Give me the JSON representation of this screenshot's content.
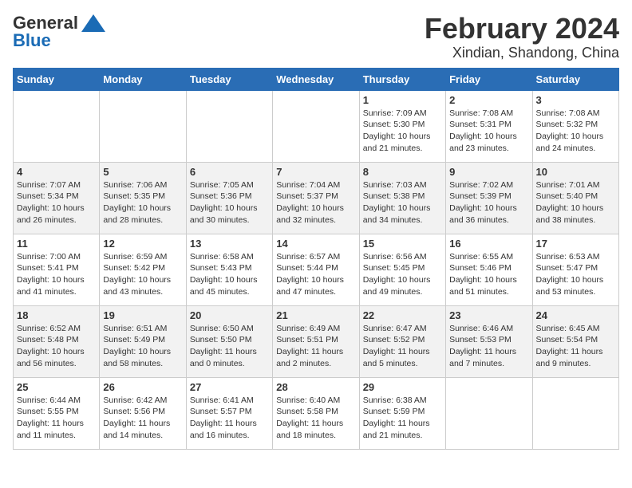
{
  "logo": {
    "general": "General",
    "blue": "Blue"
  },
  "title": "February 2024",
  "subtitle": "Xindian, Shandong, China",
  "days_of_week": [
    "Sunday",
    "Monday",
    "Tuesday",
    "Wednesday",
    "Thursday",
    "Friday",
    "Saturday"
  ],
  "weeks": [
    [
      {
        "day": "",
        "info": ""
      },
      {
        "day": "",
        "info": ""
      },
      {
        "day": "",
        "info": ""
      },
      {
        "day": "",
        "info": ""
      },
      {
        "day": "1",
        "info": "Sunrise: 7:09 AM\nSunset: 5:30 PM\nDaylight: 10 hours and 21 minutes."
      },
      {
        "day": "2",
        "info": "Sunrise: 7:08 AM\nSunset: 5:31 PM\nDaylight: 10 hours and 23 minutes."
      },
      {
        "day": "3",
        "info": "Sunrise: 7:08 AM\nSunset: 5:32 PM\nDaylight: 10 hours and 24 minutes."
      }
    ],
    [
      {
        "day": "4",
        "info": "Sunrise: 7:07 AM\nSunset: 5:34 PM\nDaylight: 10 hours and 26 minutes."
      },
      {
        "day": "5",
        "info": "Sunrise: 7:06 AM\nSunset: 5:35 PM\nDaylight: 10 hours and 28 minutes."
      },
      {
        "day": "6",
        "info": "Sunrise: 7:05 AM\nSunset: 5:36 PM\nDaylight: 10 hours and 30 minutes."
      },
      {
        "day": "7",
        "info": "Sunrise: 7:04 AM\nSunset: 5:37 PM\nDaylight: 10 hours and 32 minutes."
      },
      {
        "day": "8",
        "info": "Sunrise: 7:03 AM\nSunset: 5:38 PM\nDaylight: 10 hours and 34 minutes."
      },
      {
        "day": "9",
        "info": "Sunrise: 7:02 AM\nSunset: 5:39 PM\nDaylight: 10 hours and 36 minutes."
      },
      {
        "day": "10",
        "info": "Sunrise: 7:01 AM\nSunset: 5:40 PM\nDaylight: 10 hours and 38 minutes."
      }
    ],
    [
      {
        "day": "11",
        "info": "Sunrise: 7:00 AM\nSunset: 5:41 PM\nDaylight: 10 hours and 41 minutes."
      },
      {
        "day": "12",
        "info": "Sunrise: 6:59 AM\nSunset: 5:42 PM\nDaylight: 10 hours and 43 minutes."
      },
      {
        "day": "13",
        "info": "Sunrise: 6:58 AM\nSunset: 5:43 PM\nDaylight: 10 hours and 45 minutes."
      },
      {
        "day": "14",
        "info": "Sunrise: 6:57 AM\nSunset: 5:44 PM\nDaylight: 10 hours and 47 minutes."
      },
      {
        "day": "15",
        "info": "Sunrise: 6:56 AM\nSunset: 5:45 PM\nDaylight: 10 hours and 49 minutes."
      },
      {
        "day": "16",
        "info": "Sunrise: 6:55 AM\nSunset: 5:46 PM\nDaylight: 10 hours and 51 minutes."
      },
      {
        "day": "17",
        "info": "Sunrise: 6:53 AM\nSunset: 5:47 PM\nDaylight: 10 hours and 53 minutes."
      }
    ],
    [
      {
        "day": "18",
        "info": "Sunrise: 6:52 AM\nSunset: 5:48 PM\nDaylight: 10 hours and 56 minutes."
      },
      {
        "day": "19",
        "info": "Sunrise: 6:51 AM\nSunset: 5:49 PM\nDaylight: 10 hours and 58 minutes."
      },
      {
        "day": "20",
        "info": "Sunrise: 6:50 AM\nSunset: 5:50 PM\nDaylight: 11 hours and 0 minutes."
      },
      {
        "day": "21",
        "info": "Sunrise: 6:49 AM\nSunset: 5:51 PM\nDaylight: 11 hours and 2 minutes."
      },
      {
        "day": "22",
        "info": "Sunrise: 6:47 AM\nSunset: 5:52 PM\nDaylight: 11 hours and 5 minutes."
      },
      {
        "day": "23",
        "info": "Sunrise: 6:46 AM\nSunset: 5:53 PM\nDaylight: 11 hours and 7 minutes."
      },
      {
        "day": "24",
        "info": "Sunrise: 6:45 AM\nSunset: 5:54 PM\nDaylight: 11 hours and 9 minutes."
      }
    ],
    [
      {
        "day": "25",
        "info": "Sunrise: 6:44 AM\nSunset: 5:55 PM\nDaylight: 11 hours and 11 minutes."
      },
      {
        "day": "26",
        "info": "Sunrise: 6:42 AM\nSunset: 5:56 PM\nDaylight: 11 hours and 14 minutes."
      },
      {
        "day": "27",
        "info": "Sunrise: 6:41 AM\nSunset: 5:57 PM\nDaylight: 11 hours and 16 minutes."
      },
      {
        "day": "28",
        "info": "Sunrise: 6:40 AM\nSunset: 5:58 PM\nDaylight: 11 hours and 18 minutes."
      },
      {
        "day": "29",
        "info": "Sunrise: 6:38 AM\nSunset: 5:59 PM\nDaylight: 11 hours and 21 minutes."
      },
      {
        "day": "",
        "info": ""
      },
      {
        "day": "",
        "info": ""
      }
    ]
  ]
}
